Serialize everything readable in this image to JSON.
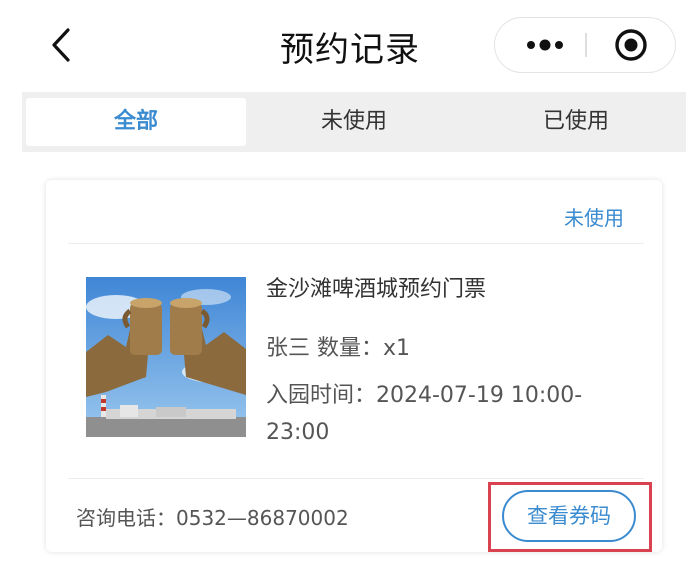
{
  "header": {
    "title": "预约记录",
    "back_icon": "chevron-left-icon",
    "more_icon": "more-dots-icon",
    "close_icon": "target-close-icon"
  },
  "tabs": [
    {
      "label": "全部",
      "active": true
    },
    {
      "label": "未使用",
      "active": false
    },
    {
      "label": "已使用",
      "active": false
    }
  ],
  "record": {
    "status": "未使用",
    "ticket_name": "金沙滩啤酒城预约门票",
    "person_qty": "张三 数量：x1",
    "time_line1": "入园时间：2024-07-19 10:00-",
    "time_line2": "23:00",
    "phone": "咨询电话：0532—86870002",
    "action_label": "查看券码"
  },
  "colors": {
    "accent": "#3b8bd1",
    "highlight_frame": "#d9434f",
    "tab_bar_bg": "#efefef"
  }
}
